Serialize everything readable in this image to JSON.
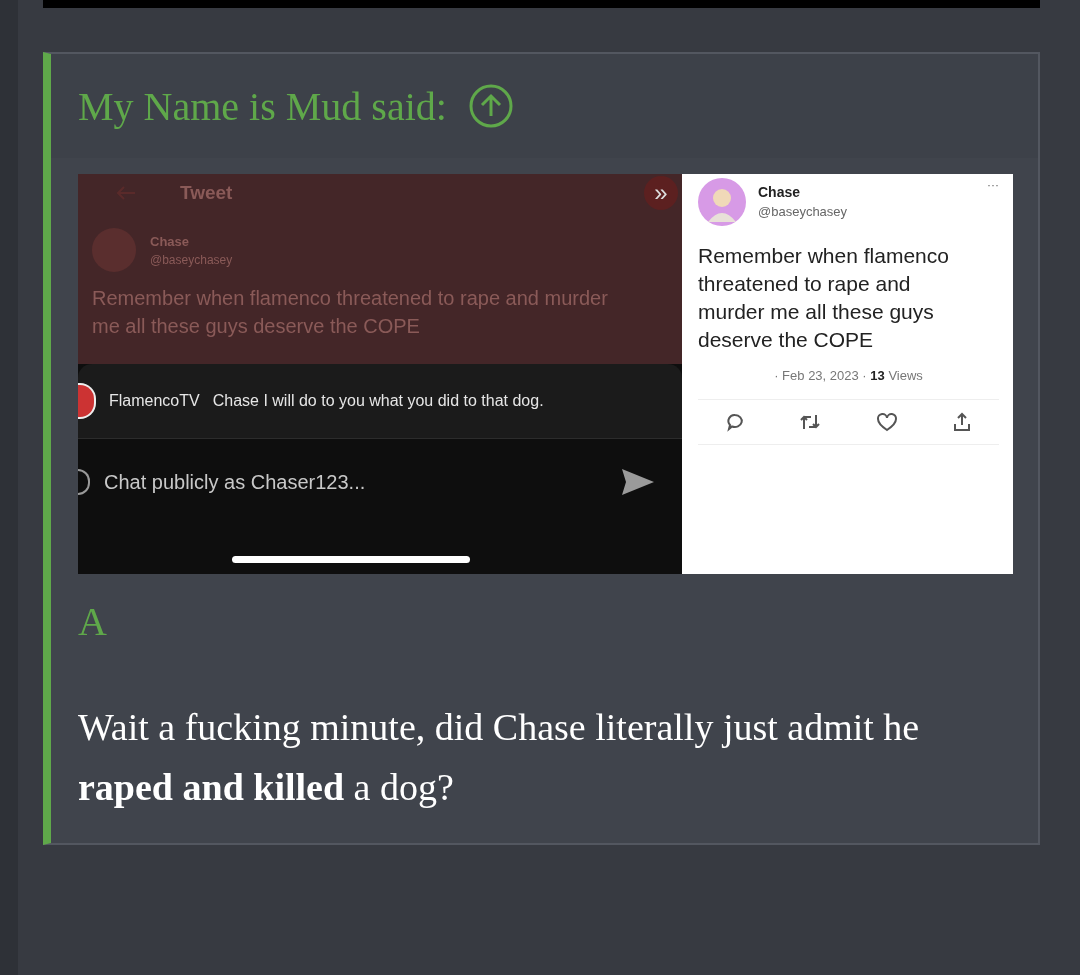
{
  "quote": {
    "author": "My Name is Mud said:",
    "screenshot": {
      "background_tweet": {
        "header": "Tweet",
        "name": "Chase",
        "handle": "@baseychasey",
        "text": "Remember when flamenco threatened to rape and murder me all these guys deserve the COPE",
        "expand": "»"
      },
      "chat_message": {
        "user": "FlamencoTV",
        "text": "Chase I will do to you what you did to that dog."
      },
      "chat_input": {
        "placeholder": "Chat publicly as Chaser123..."
      },
      "tweet": {
        "name": "Chase",
        "handle": "@baseychasey",
        "more": "···",
        "text": "Remember when flamenco threatened to rape and murder me all these guys deserve the COPE",
        "date": "· Feb 23, 2023 · ",
        "views_count": "13",
        "views_label": " Views"
      }
    },
    "first_line": "A",
    "message": "Wait a fucking minute, did Chase literally just admit he **raped and killed** a dog?"
  }
}
